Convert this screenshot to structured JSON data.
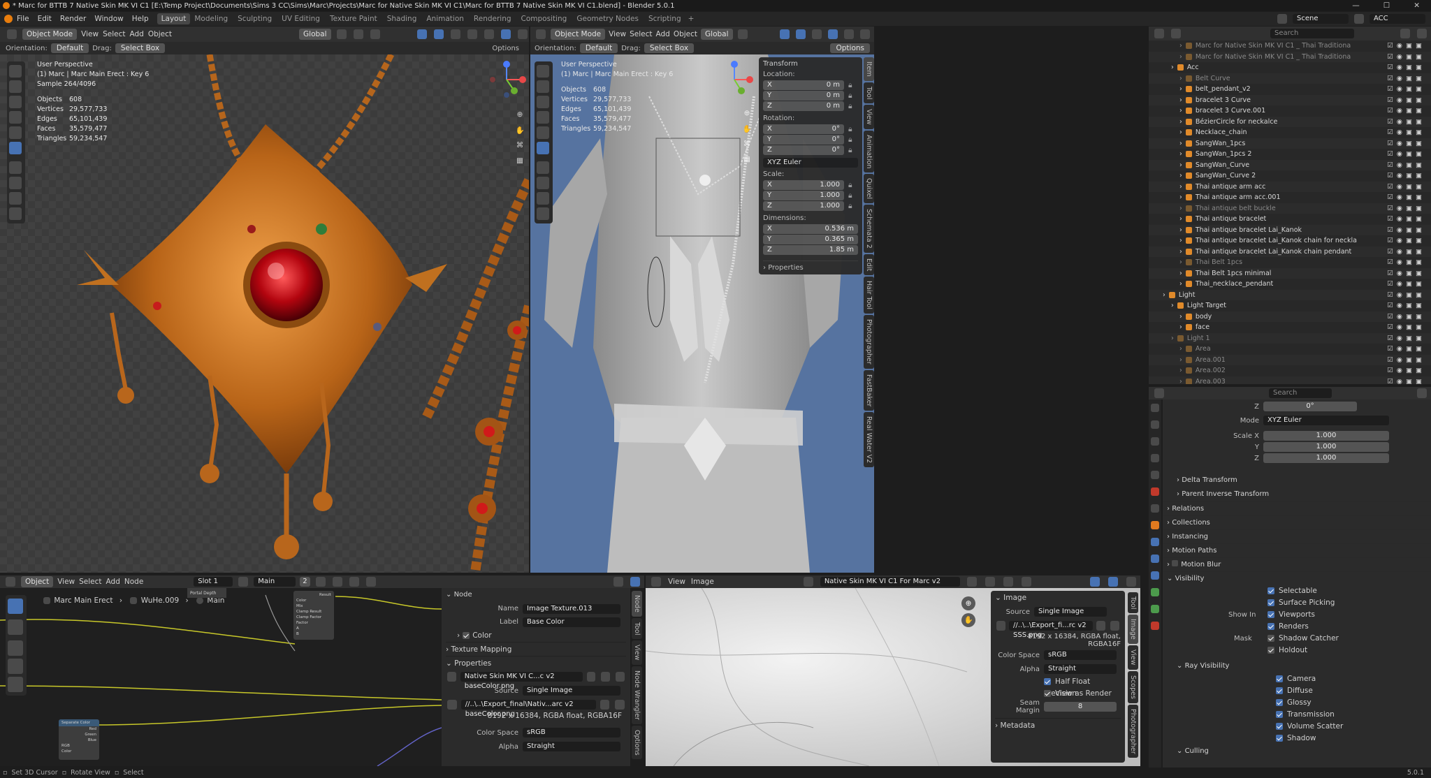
{
  "window": {
    "title": "* Marc for BTTB 7 Native Skin MK VI C1 [E:\\Temp Project\\Documents\\Sims 3 CC\\Sims\\Marc\\Projects\\Marc for Native Skin MK VI C1\\Marc for BTTB 7 Native Skin MK VI C1.blend] - Blender 5.0.1"
  },
  "menu": [
    "File",
    "Edit",
    "Render",
    "Window",
    "Help"
  ],
  "workspaces": [
    "Layout",
    "Modeling",
    "Sculpting",
    "UV Editing",
    "Texture Paint",
    "Shading",
    "Animation",
    "Rendering",
    "Compositing",
    "Geometry Nodes",
    "Scripting"
  ],
  "topright": {
    "scene": "Scene",
    "view_layer": "ACC"
  },
  "viewport_left": {
    "mode": "Object Mode",
    "menus": [
      "View",
      "Select",
      "Add",
      "Object"
    ],
    "transform": "Global",
    "orientation_label": "Orientation:",
    "orientation": "Default",
    "drag_label": "Drag:",
    "drag": "Select Box",
    "options": "Options",
    "overlay": [
      "User Perspective",
      "(1) Marc | Marc Main Erect : Key 6",
      "Sample 264/4096"
    ],
    "stats": [
      [
        "Objects",
        "608"
      ],
      [
        "Vertices",
        "29,577,733"
      ],
      [
        "Edges",
        "65,101,439"
      ],
      [
        "Faces",
        "35,579,477"
      ],
      [
        "Triangles",
        "59,234,547"
      ]
    ]
  },
  "viewport_right": {
    "mode": "Object Mode",
    "menus": [
      "View",
      "Select",
      "Add",
      "Object"
    ],
    "transform": "Global",
    "orientation_label": "Orientation:",
    "orientation": "Default",
    "drag_label": "Drag:",
    "drag": "Select Box",
    "options": "Options",
    "overlay": [
      "User Perspective",
      "(1) Marc | Marc Main Erect : Key 6"
    ],
    "stats": [
      [
        "Objects",
        "608"
      ],
      [
        "Vertices",
        "29,577,733"
      ],
      [
        "Edges",
        "65,101,439"
      ],
      [
        "Faces",
        "35,579,477"
      ],
      [
        "Triangles",
        "59,234,547"
      ]
    ],
    "npanel": {
      "title": "Transform",
      "location_label": "Location:",
      "location": [
        [
          "X",
          "0 m"
        ],
        [
          "Y",
          "0 m"
        ],
        [
          "Z",
          "0 m"
        ]
      ],
      "rotation_label": "Rotation:",
      "rotation": [
        [
          "X",
          "0°"
        ],
        [
          "Y",
          "0°"
        ],
        [
          "Z",
          "0°"
        ]
      ],
      "rotation_mode": "XYZ Euler",
      "scale_label": "Scale:",
      "scale": [
        [
          "X",
          "1.000"
        ],
        [
          "Y",
          "1.000"
        ],
        [
          "Z",
          "1.000"
        ]
      ],
      "dimensions_label": "Dimensions:",
      "dimensions": [
        [
          "X",
          "0.536 m"
        ],
        [
          "Y",
          "0.365 m"
        ],
        [
          "Z",
          "1.85 m"
        ]
      ],
      "properties": "Properties"
    },
    "tabs": [
      "Item",
      "Tool",
      "View",
      "Animation",
      "Quixel",
      "Schemata 2",
      "Edit",
      "Hair Tool",
      "Photographer",
      "FastBaker",
      "Real Water V2"
    ]
  },
  "outliner": {
    "search": "Search",
    "items": [
      {
        "name": "Marc for Native Skin MK VI C1 _ Thai Traditiona",
        "indent": 3,
        "dim": true
      },
      {
        "name": "Marc for Native Skin MK VI C1 _ Thai Traditiona",
        "indent": 3,
        "dim": true
      },
      {
        "name": "Acc",
        "indent": 2,
        "dim": false
      },
      {
        "name": "Belt Curve",
        "indent": 3,
        "dim": true
      },
      {
        "name": "belt_pendant_v2",
        "indent": 3,
        "dim": false
      },
      {
        "name": "bracelet 3 Curve",
        "indent": 3,
        "dim": false
      },
      {
        "name": "bracelet 3 Curve.001",
        "indent": 3,
        "dim": false
      },
      {
        "name": "BézierCircle for neckalce",
        "indent": 3,
        "dim": false
      },
      {
        "name": "Necklace_chain",
        "indent": 3,
        "dim": false
      },
      {
        "name": "SangWan_1pcs",
        "indent": 3,
        "dim": false
      },
      {
        "name": "SangWan_1pcs 2",
        "indent": 3,
        "dim": false
      },
      {
        "name": "SangWan_Curve",
        "indent": 3,
        "dim": false
      },
      {
        "name": "SangWan_Curve 2",
        "indent": 3,
        "dim": false
      },
      {
        "name": "Thai antique arm acc",
        "indent": 3,
        "dim": false
      },
      {
        "name": "Thai antique arm acc.001",
        "indent": 3,
        "dim": false
      },
      {
        "name": "Thai antique belt buckle",
        "indent": 3,
        "dim": true
      },
      {
        "name": "Thai antique bracelet",
        "indent": 3,
        "dim": false
      },
      {
        "name": "Thai antique bracelet Lai_Kanok",
        "indent": 3,
        "dim": false
      },
      {
        "name": "Thai antique bracelet Lai_Kanok chain for neckla",
        "indent": 3,
        "dim": false
      },
      {
        "name": "Thai antique bracelet Lai_Kanok chain pendant",
        "indent": 3,
        "dim": false
      },
      {
        "name": "Thai Belt 1pcs",
        "indent": 3,
        "dim": true
      },
      {
        "name": "Thai Belt 1pcs minimal",
        "indent": 3,
        "dim": false
      },
      {
        "name": "Thai_necklace_pendant",
        "indent": 3,
        "dim": false
      },
      {
        "name": "Light",
        "indent": 1,
        "dim": false
      },
      {
        "name": "Light Target",
        "indent": 2,
        "dim": false
      },
      {
        "name": "body",
        "indent": 3,
        "dim": false
      },
      {
        "name": "face",
        "indent": 3,
        "dim": false
      },
      {
        "name": "Light 1",
        "indent": 2,
        "dim": true
      },
      {
        "name": "Area",
        "indent": 3,
        "dim": true
      },
      {
        "name": "Area.001",
        "indent": 3,
        "dim": true
      },
      {
        "name": "Area.002",
        "indent": 3,
        "dim": true
      },
      {
        "name": "Area.003",
        "indent": 3,
        "dim": true
      }
    ]
  },
  "properties": {
    "search": "Search",
    "rot_z": [
      "Z",
      "0°"
    ],
    "mode_label": "Mode",
    "mode": "XYZ Euler",
    "scale": [
      [
        "Scale X",
        "1.000"
      ],
      [
        "Y",
        "1.000"
      ],
      [
        "Z",
        "1.000"
      ]
    ],
    "sub": [
      "Delta Transform",
      "Parent Inverse Transform"
    ],
    "sections": [
      "Relations",
      "Collections",
      "Instancing",
      "Motion Paths",
      "Motion Blur",
      "Visibility"
    ],
    "visibility": {
      "selectable": "Selectable",
      "surface_picking": "Surface Picking",
      "show_in_label": "Show In",
      "viewports": "Viewports",
      "renders": "Renders",
      "mask_label": "Mask",
      "shadow_catcher": "Shadow Catcher",
      "holdout": "Holdout"
    },
    "ray_visibility": {
      "title": "Ray Visibility",
      "items": [
        "Camera",
        "Diffuse",
        "Glossy",
        "Transmission",
        "Volume Scatter",
        "Shadow"
      ]
    },
    "culling": "Culling"
  },
  "node_editor": {
    "type": "Object",
    "menus": [
      "View",
      "Select",
      "Add",
      "Node"
    ],
    "slot": "Slot 1",
    "material": "Main",
    "users": "2",
    "breadcrumb": [
      "Marc Main Erect",
      "WuHe.009",
      "Main"
    ],
    "nodes": {
      "portal": "Portal Depth",
      "mix": [
        "Color",
        "Mix",
        "Clamp Result",
        "Clamp Factor",
        "Factor",
        "A",
        "B"
      ],
      "result": "Result",
      "sep": "Separate Color",
      "sep_out": [
        "Red",
        "Green",
        "Blue"
      ],
      "sep_in": [
        "RGB",
        "Color"
      ]
    },
    "panel": {
      "node_title": "Node",
      "name_label": "Name",
      "name": "Image Texture.013",
      "label_label": "Label",
      "label": "Base Color",
      "color": "Color",
      "texture_mapping": "Texture Mapping",
      "properties": "Properties",
      "image": "Native Skin MK VI C...c v2 baseColor.png",
      "source_label": "Source",
      "source": "Single Image",
      "path": "//..\\..\\Export_final\\Nativ...arc v2 baseColor.png",
      "info": "8192 x 16384, RGBA float, RGBA16F",
      "colorspace_label": "Color Space",
      "colorspace": "sRGB",
      "alpha_label": "Alpha",
      "alpha": "Straight"
    },
    "tabs": [
      "Node",
      "Tool",
      "View",
      "Node Wrangler",
      "Options"
    ]
  },
  "image_editor": {
    "menus": [
      "View",
      "Image"
    ],
    "image": "Native Skin MK VI C1 For Marc v2 SSS.png",
    "panel": {
      "title": "Image",
      "source_label": "Source",
      "source": "Single Image",
      "path": "//..\\..\\Export_fi...rc v2 SSS.png",
      "info": "8192 x 16384, RGBA float, RGBA16F",
      "colorspace_label": "Color Space",
      "colorspace": "sRGB",
      "alpha_label": "Alpha",
      "alpha": "Straight",
      "half_float": "Half Float Precision",
      "view_render": "View as Render",
      "seam_label": "Seam Margin",
      "seam": "8",
      "metadata": "Metadata"
    },
    "tabs": [
      "Tool",
      "Image",
      "View",
      "Scopes",
      "Photographer"
    ]
  },
  "status": {
    "items": [
      "Set 3D Cursor",
      "Rotate View",
      "Select"
    ],
    "version": "5.0.1"
  }
}
